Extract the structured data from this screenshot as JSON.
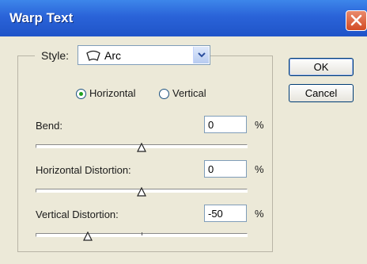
{
  "window": {
    "title": "Warp Text"
  },
  "style": {
    "label": "Style:",
    "value": "Arc",
    "icon": "arc-icon"
  },
  "orientation": {
    "horizontal_label": "Horizontal",
    "vertical_label": "Vertical",
    "selected": "Horizontal"
  },
  "bend": {
    "label": "Bend:",
    "value": "0",
    "unit": "%",
    "percent": 0
  },
  "horizontal_distortion": {
    "label": "Horizontal Distortion:",
    "value": "0",
    "unit": "%",
    "percent": 0
  },
  "vertical_distortion": {
    "label": "Vertical Distortion:",
    "value": "-50",
    "unit": "%",
    "percent": -50
  },
  "buttons": {
    "ok": "OK",
    "cancel": "Cancel"
  },
  "colors": {
    "titlebar": "#2a63d8",
    "background": "#ece9d8",
    "close": "#d24b24",
    "radio_dot": "#21a121"
  }
}
